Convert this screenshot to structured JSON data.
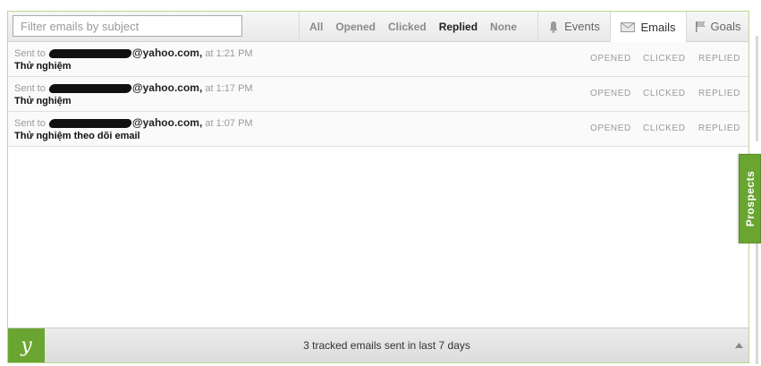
{
  "search": {
    "placeholder": "Filter emails by subject"
  },
  "filters": [
    "All",
    "Opened",
    "Clicked",
    "Replied",
    "None"
  ],
  "active_filter": "Replied",
  "tabs": {
    "events": "Events",
    "emails": "Emails",
    "goals": "Goals"
  },
  "rows": [
    {
      "sent_prefix": "Sent to",
      "email_visible": "@yahoo.com,",
      "time": "at 1:21 PM",
      "subject": "Thử nghiệm",
      "opened": "OPENED",
      "clicked": "CLICKED",
      "replied": "REPLIED"
    },
    {
      "sent_prefix": "Sent to",
      "email_visible": "@yahoo.com,",
      "time": "at 1:17 PM",
      "subject": "Thử nghiệm",
      "opened": "OPENED",
      "clicked": "CLICKED",
      "replied": "REPLIED"
    },
    {
      "sent_prefix": "Sent to",
      "email_visible": "@yahoo.com,",
      "time": "at 1:07 PM",
      "subject": "Thử nghiệm theo dõi email",
      "opened": "OPENED",
      "clicked": "CLICKED",
      "replied": "REPLIED"
    }
  ],
  "footer": {
    "logo": "y",
    "summary": "3 tracked emails sent in last 7 days"
  },
  "side_tab": {
    "label": "Prospects"
  },
  "colors": {
    "accent": "#6aa532",
    "border": "#b8d98f"
  }
}
